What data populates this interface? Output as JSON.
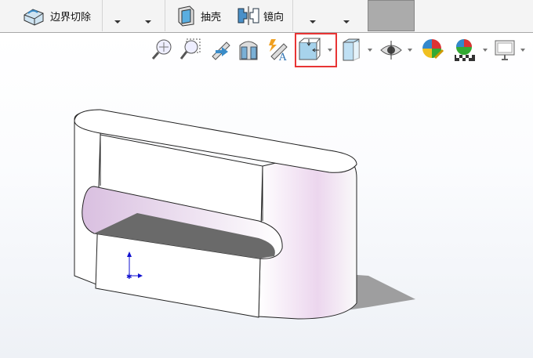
{
  "toolbar": {
    "boundary_cut": "边界切除",
    "shell": "抽壳",
    "mirror": "镜向"
  },
  "heads_up": [
    "zoom-to-fit",
    "zoom-to-area",
    "previous-view",
    "section-view",
    "dynamic-annotation-views",
    "view-orientation",
    "display-style",
    "hide-show-items",
    "edit-appearance",
    "apply-scene",
    "view-settings"
  ],
  "colors": {
    "highlight": "#e83434"
  }
}
